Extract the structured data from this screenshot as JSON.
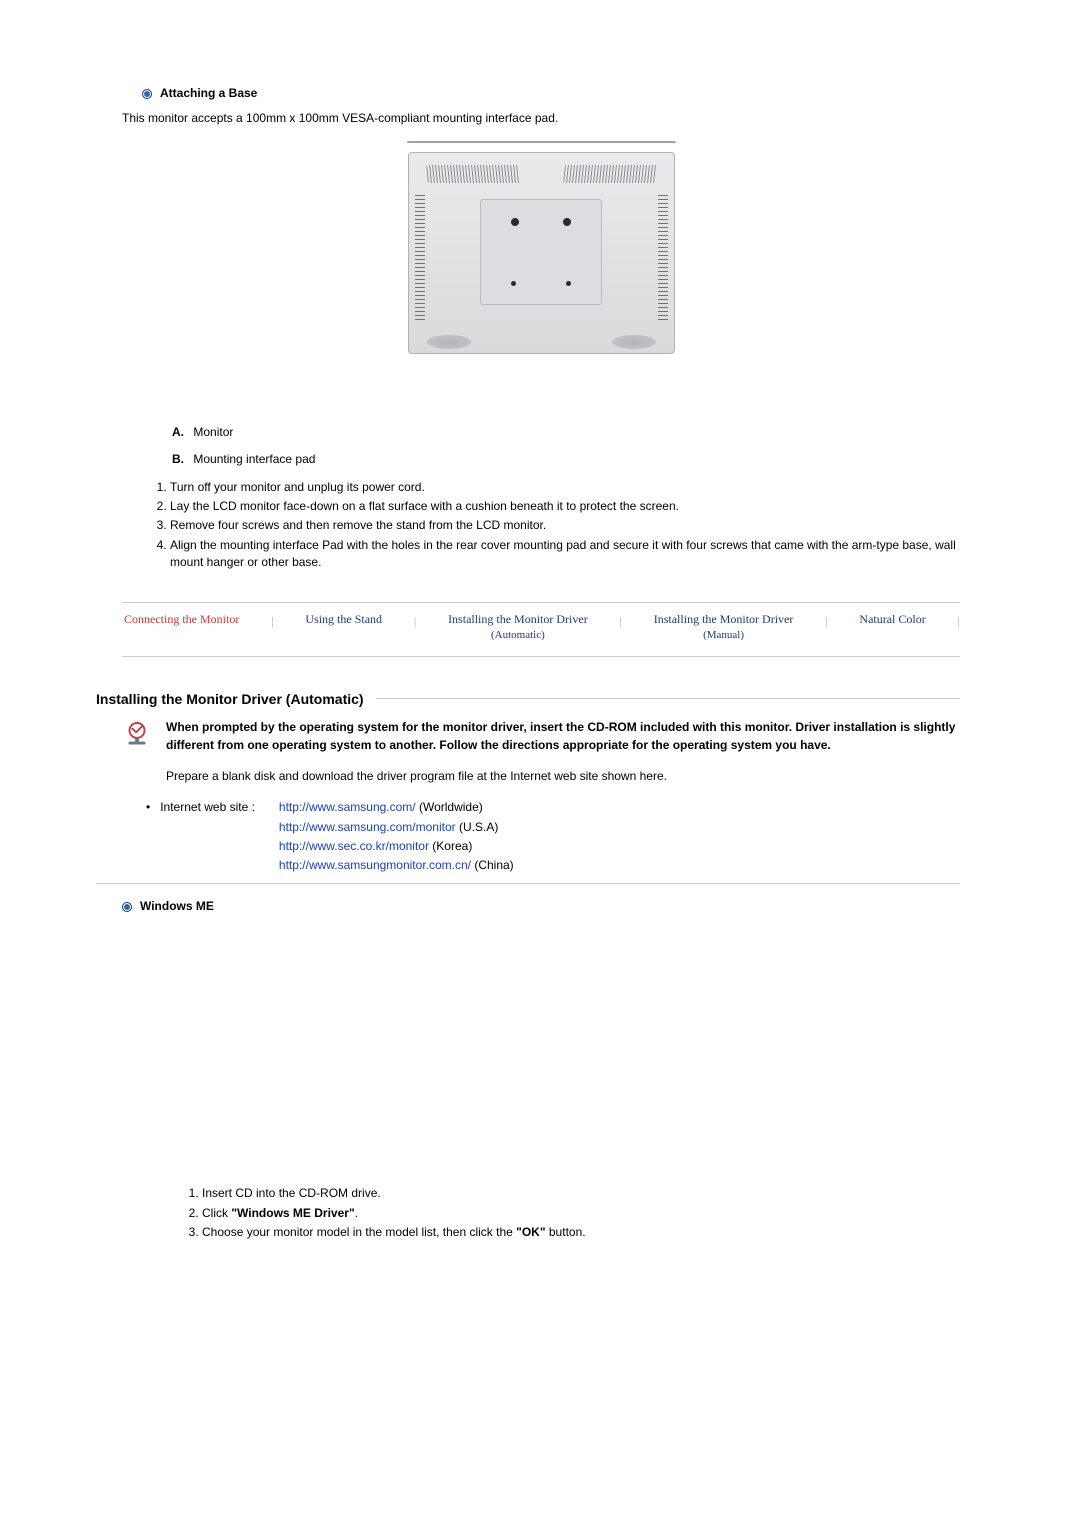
{
  "section1": {
    "title": "Attaching a Base",
    "intro": "This monitor accepts a 100mm x 100mm VESA-compliant mounting interface pad.",
    "labels": {
      "a_key": "A.",
      "a_val": "Monitor",
      "b_key": "B.",
      "b_val": "Mounting interface pad"
    },
    "steps": [
      "Turn off your monitor and unplug its power cord.",
      "Lay the LCD monitor face-down on a flat surface with a cushion beneath it to protect the screen.",
      "Remove four screws and then remove the stand from the LCD monitor.",
      "Align the mounting interface Pad with the holes in the rear cover mounting pad and secure it with four screws that came with the arm-type base, wall mount hanger or other base."
    ]
  },
  "tabs": {
    "t1": "Connecting  the Monitor",
    "t2": "Using the Stand",
    "t3": "Installing the Monitor Driver",
    "t3b": "(Automatic)",
    "t4": "Installing the Monitor Driver",
    "t4b": "(Manual)",
    "t5": "Natural Color"
  },
  "section2": {
    "title": "Installing the Monitor Driver (Automatic)",
    "note_bold": "When prompted by the operating system for the monitor driver, insert the CD-ROM included with this monitor. Driver installation is slightly different from one operating system to another. Follow the directions appropriate for the operating system you have.",
    "prepare": "Prepare a blank disk and download the driver program file at the Internet web site shown here."
  },
  "links": {
    "label": "Internet web site :",
    "items": [
      {
        "url": "http://www.samsung.com/",
        "suffix": " (Worldwide)"
      },
      {
        "url": "http://www.samsung.com/monitor",
        "suffix": " (U.S.A)"
      },
      {
        "url": "http://www.sec.co.kr/monitor",
        "suffix": " (Korea)"
      },
      {
        "url": "http://www.samsungmonitor.com.cn/",
        "suffix": " (China)"
      }
    ]
  },
  "winme": {
    "title": "Windows ME",
    "steps": [
      {
        "pre": "Insert CD into the CD-ROM drive."
      },
      {
        "pre": "Click ",
        "bold": "\"Windows ME Driver\"",
        "post": "."
      },
      {
        "pre": "Choose your monitor model in the model list, then click the ",
        "bold": "\"OK\"",
        "post": " button."
      }
    ]
  }
}
